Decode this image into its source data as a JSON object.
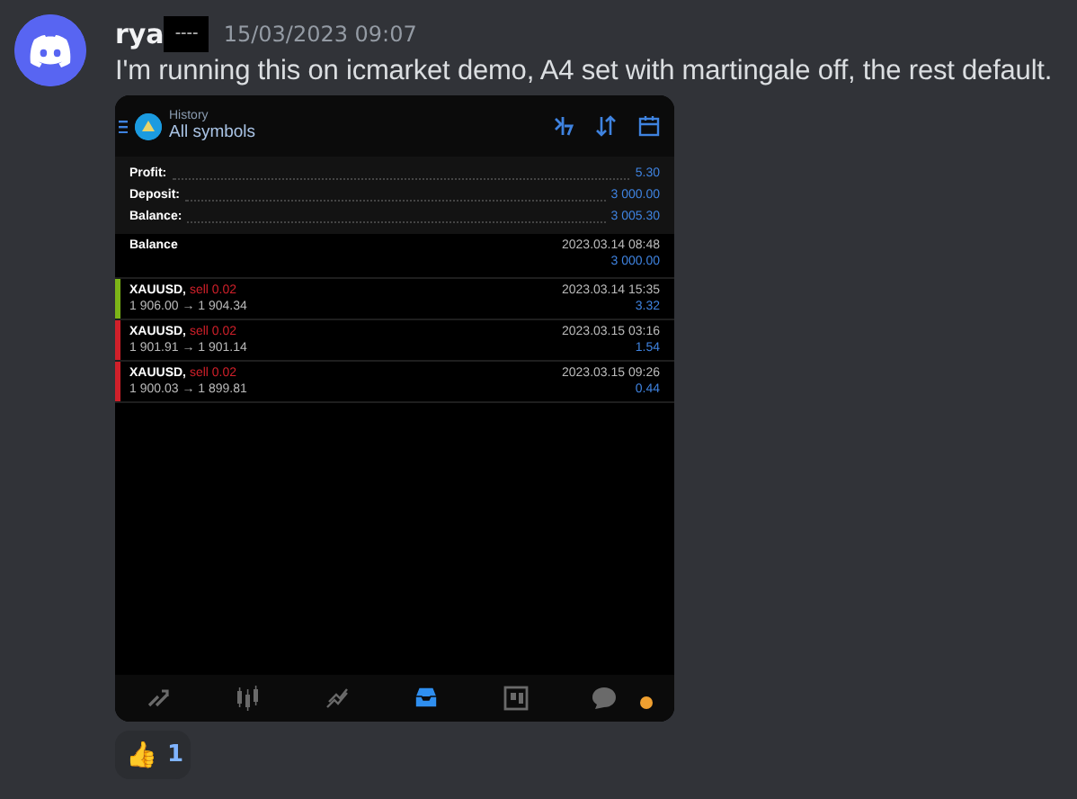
{
  "message": {
    "author": "rya",
    "redacted": "----",
    "timestamp": "15/03/2023 09:07",
    "text": "I'm running this on icmarket demo, A4 set with martingale off, the rest default."
  },
  "attachment": {
    "header": {
      "subtitle": "History",
      "title": "All symbols"
    },
    "summary": [
      {
        "label": "Profit:",
        "value": "5.30"
      },
      {
        "label": "Deposit:",
        "value": "3 000.00"
      },
      {
        "label": "Balance:",
        "value": "3 005.30"
      }
    ],
    "balance_row": {
      "label": "Balance",
      "time": "2023.03.14 08:48",
      "amount": "3 000.00"
    },
    "trades": [
      {
        "symbol": "XAUUSD,",
        "side": "sell 0.02",
        "prices": "1 906.00 → 1 904.34",
        "time": "2023.03.14 15:35",
        "profit": "3.32",
        "color": "#7cb518"
      },
      {
        "symbol": "XAUUSD,",
        "side": "sell 0.02",
        "prices": "1 901.91 → 1 901.14",
        "time": "2023.03.15 03:16",
        "profit": "1.54",
        "color": "#d0202a"
      },
      {
        "symbol": "XAUUSD,",
        "side": "sell 0.02",
        "prices": "1 900.03 → 1 899.81",
        "time": "2023.03.15 09:26",
        "profit": "0.44",
        "color": "#d0202a"
      }
    ],
    "nav": [
      {
        "kind": "trade",
        "selected": false
      },
      {
        "kind": "quotes",
        "selected": false
      },
      {
        "kind": "chart",
        "selected": false
      },
      {
        "kind": "history",
        "selected": true
      },
      {
        "kind": "news",
        "selected": false
      },
      {
        "kind": "chat",
        "selected": false
      }
    ]
  },
  "reaction": {
    "emoji": "👍",
    "count": "1"
  }
}
